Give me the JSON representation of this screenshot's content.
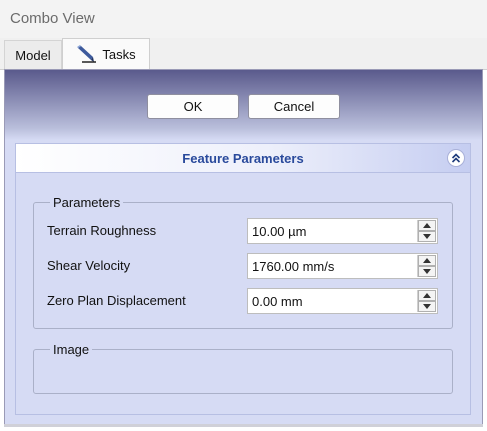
{
  "window": {
    "title": "Combo View"
  },
  "tabs": [
    {
      "label": "Model",
      "icon": null
    },
    {
      "label": "Tasks",
      "icon": "pencil-icon"
    }
  ],
  "dialog": {
    "ok_label": "OK",
    "cancel_label": "Cancel"
  },
  "task_box": {
    "title": "Feature Parameters",
    "collapse_icon": "double-chevron-up-icon"
  },
  "parameters": {
    "legend": "Parameters",
    "rows": [
      {
        "label": "Terrain Roughness",
        "value": "10.00 µm"
      },
      {
        "label": "Shear Velocity",
        "value": "1760.00 mm/s"
      },
      {
        "label": "Zero Plan Displacement",
        "value": "0.00 mm"
      }
    ]
  },
  "image_group": {
    "legend": "Image"
  },
  "colors": {
    "header_text": "#2a4a9c",
    "panel_gradient_top": "#5a5a8c",
    "panel_body": "#d6dbf4"
  }
}
